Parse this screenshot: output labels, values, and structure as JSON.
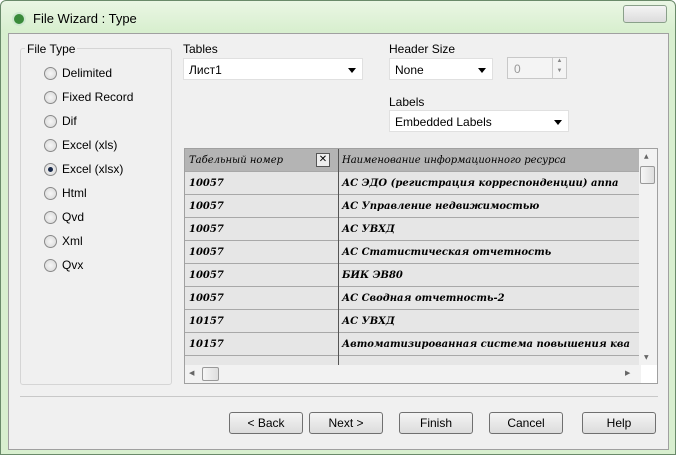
{
  "window": {
    "title": "File Wizard : Type"
  },
  "file_type": {
    "label": "File Type",
    "options": [
      {
        "label": "Delimited",
        "selected": false
      },
      {
        "label": "Fixed Record",
        "selected": false
      },
      {
        "label": "Dif",
        "selected": false
      },
      {
        "label": "Excel (xls)",
        "selected": false
      },
      {
        "label": "Excel (xlsx)",
        "selected": true
      },
      {
        "label": "Html",
        "selected": false
      },
      {
        "label": "Qvd",
        "selected": false
      },
      {
        "label": "Xml",
        "selected": false
      },
      {
        "label": "Qvx",
        "selected": false
      }
    ]
  },
  "tables": {
    "label": "Tables",
    "value": "Лист1"
  },
  "header_size": {
    "label": "Header Size",
    "value": "None",
    "spin_value": "0"
  },
  "labels": {
    "label": "Labels",
    "value": "Embedded Labels"
  },
  "grid": {
    "columns": [
      "Табельный номер",
      "Наименование информационного ресурса"
    ],
    "rows": [
      [
        "10057",
        "АС ЭДО (регистрация корреспонденции) аппа"
      ],
      [
        "10057",
        "АС Управление недвижимостью"
      ],
      [
        "10057",
        "АС УВХД"
      ],
      [
        "10057",
        "АС Статистическая отчетность"
      ],
      [
        "10057",
        "БИК ЭВ80"
      ],
      [
        "10057",
        "АС Сводная отчетность-2"
      ],
      [
        "10157",
        "АС УВХД"
      ],
      [
        "10157",
        "Автоматизированная система повышения ква"
      ]
    ]
  },
  "buttons": {
    "back": "< Back",
    "next": "Next >",
    "finish": "Finish",
    "cancel": "Cancel",
    "help": "Help"
  }
}
